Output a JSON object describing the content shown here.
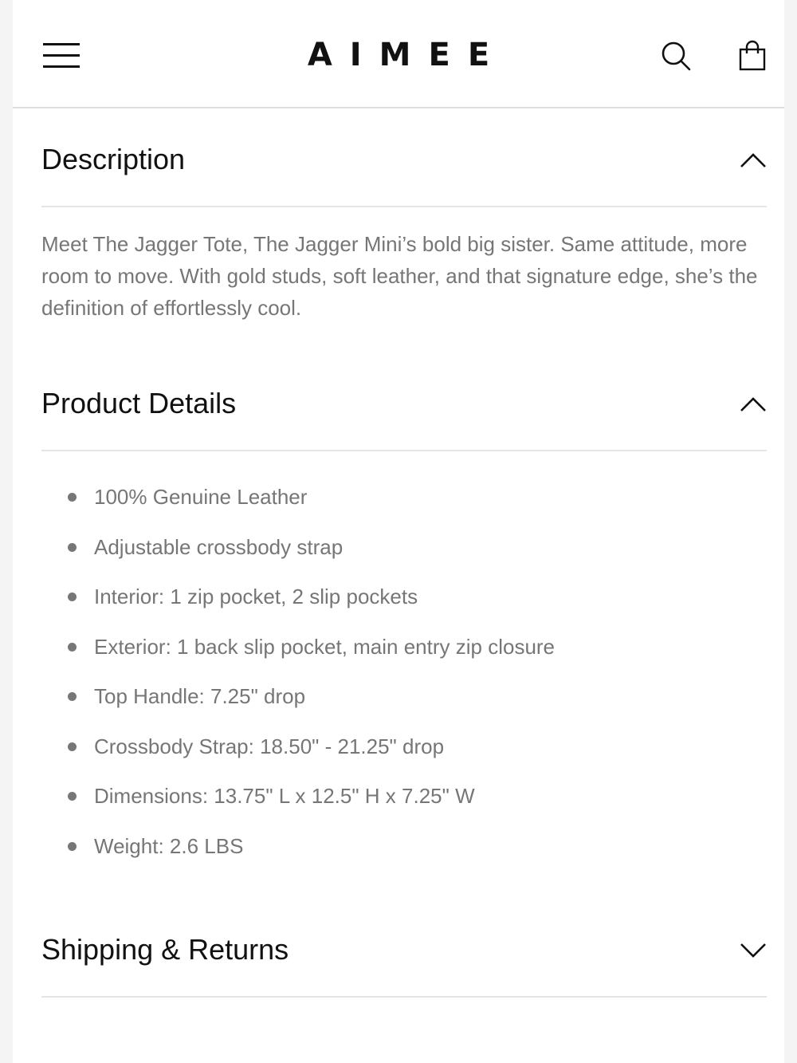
{
  "header": {
    "brand": "AIMEE",
    "menu_icon": "hamburger-menu-icon",
    "search_icon": "search-icon",
    "cart_icon": "shopping-bag-icon"
  },
  "sections": [
    {
      "title": "Description",
      "expanded": true,
      "text": "Meet The Jagger Tote, The Jagger Mini’s bold big sister. Same attitude, more room to move. With gold studs, soft leather, and that signature edge, she’s the definition of effortlessly cool."
    },
    {
      "title": "Product Details",
      "expanded": true,
      "items": [
        "100% Genuine Leather",
        "Adjustable crossbody strap",
        "Interior: 1 zip pocket, 2 slip pockets",
        "Exterior: 1 back slip pocket, main entry zip closure",
        "Top Handle: 7.25\" drop",
        "Crossbody Strap: 18.50\" - 21.25\" drop",
        "Dimensions: 13.75\" L x 12.5\" H x 7.25\" W",
        "Weight: 2.6 LBS"
      ]
    },
    {
      "title": "Shipping & Returns",
      "expanded": false
    }
  ]
}
